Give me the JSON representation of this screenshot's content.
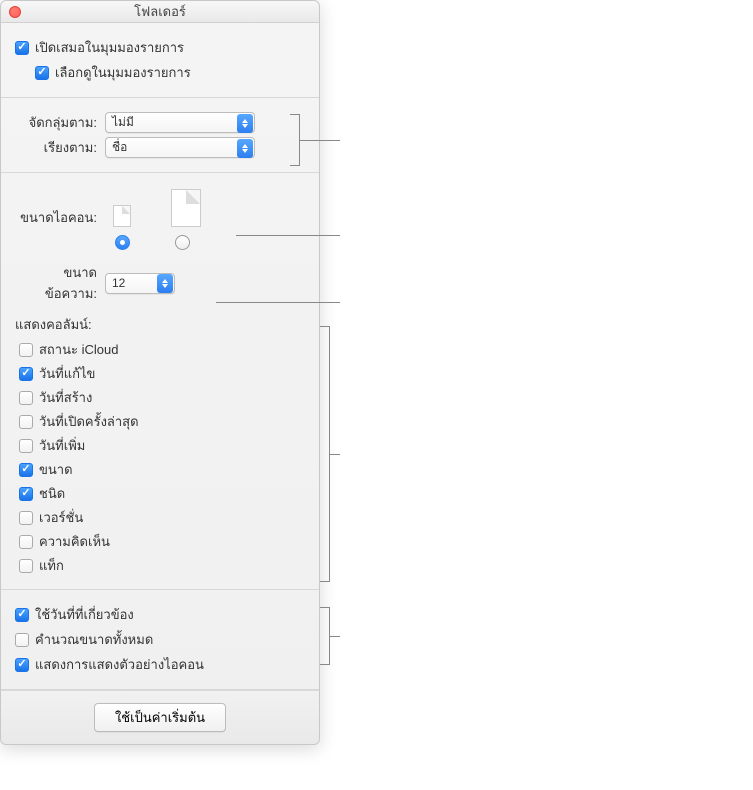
{
  "window": {
    "title": "โฟลเดอร์"
  },
  "top": {
    "always_open_list": {
      "label": "เปิดเสมอในมุมมองรายการ",
      "checked": true
    },
    "browse_list": {
      "label": "เลือกดูในมุมมองรายการ",
      "checked": true
    }
  },
  "sort": {
    "group_by_label": "จัดกลุ่มตาม:",
    "group_by_value": "ไม่มี",
    "sort_by_label": "เรียงตาม:",
    "sort_by_value": "ชื่อ"
  },
  "icon_size": {
    "label": "ขนาดไอคอน:",
    "selected": "small"
  },
  "text_size": {
    "label": "ขนาดข้อความ:",
    "value": "12"
  },
  "columns": {
    "heading": "แสดงคอลัมน์:",
    "items": [
      {
        "label": "สถานะ iCloud",
        "checked": false
      },
      {
        "label": "วันที่แก้ไข",
        "checked": true
      },
      {
        "label": "วันที่สร้าง",
        "checked": false
      },
      {
        "label": "วันที่เปิดครั้งล่าสุด",
        "checked": false
      },
      {
        "label": "วันที่เพิ่ม",
        "checked": false
      },
      {
        "label": "ขนาด",
        "checked": true
      },
      {
        "label": "ชนิด",
        "checked": true
      },
      {
        "label": "เวอร์ชั่น",
        "checked": false
      },
      {
        "label": "ความคิดเห็น",
        "checked": false
      },
      {
        "label": "แท็ก",
        "checked": false
      }
    ]
  },
  "opts": {
    "relative_dates": {
      "label": "ใช้วันที่ที่เกี่ยวข้อง",
      "checked": true
    },
    "calc_sizes": {
      "label": "คำนวณขนาดทั้งหมด",
      "checked": false
    },
    "show_preview": {
      "label": "แสดงการแสดงตัวอย่างไอคอน",
      "checked": true
    }
  },
  "footer": {
    "use_defaults": "ใช้เป็นค่าเริ่มต้น"
  }
}
